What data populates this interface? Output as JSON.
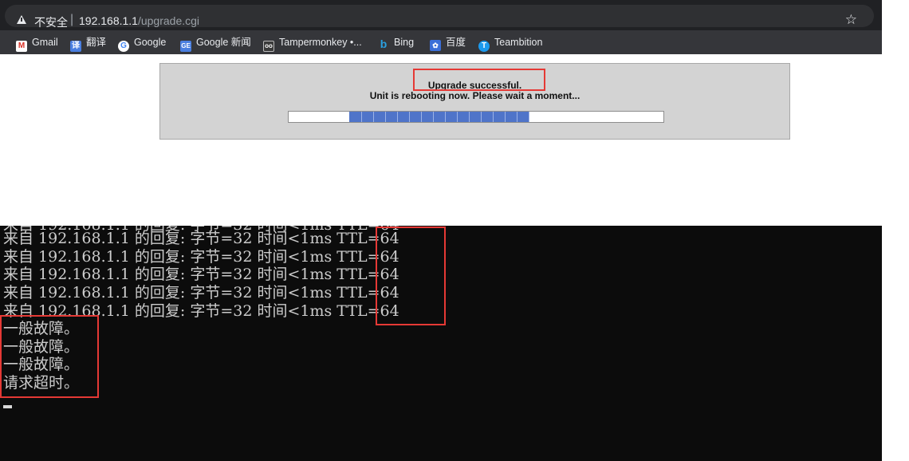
{
  "browser": {
    "security_label": "不安全",
    "separator": "|",
    "url_host": "192.168.1.1",
    "url_path": "/upgrade.cgi"
  },
  "bookmarks": [
    {
      "label": "Gmail",
      "icon": "gmail-icon"
    },
    {
      "label": "翻译",
      "icon": "translate-icon"
    },
    {
      "label": "Google",
      "icon": "google-icon"
    },
    {
      "label": "Google 新闻",
      "icon": "google-news-icon"
    },
    {
      "label": "Tampermonkey •...",
      "icon": "tampermonkey-icon"
    },
    {
      "label": "Bing",
      "icon": "bing-icon"
    },
    {
      "label": "百度",
      "icon": "baidu-icon"
    },
    {
      "label": "Teambition",
      "icon": "teambition-icon"
    }
  ],
  "router": {
    "status_title": "Upgrade successful.",
    "status_message": "Unit is rebooting now. Please wait a moment...",
    "progress_fraction": 0.48
  },
  "console": {
    "partial_line": "来自 192.168.1.1 的回复: 字节=32 时间<1ms TTL=64",
    "lines": [
      "来自 192.168.1.1 的回复: 字节=32 时间<1ms TTL=64",
      "来自 192.168.1.1 的回复: 字节=32 时间<1ms TTL=64",
      "来自 192.168.1.1 的回复: 字节=32 时间<1ms TTL=64",
      "来自 192.168.1.1 的回复: 字节=32 时间<1ms TTL=64",
      "来自 192.168.1.1 的回复: 字节=32 时间<1ms TTL=64",
      "一般故障。",
      "一般故障。",
      "一般故障。",
      "请求超时。"
    ]
  },
  "colors": {
    "highlight": "#e53935",
    "progress": "#4f74c9",
    "console_bg": "#0c0c0c"
  }
}
